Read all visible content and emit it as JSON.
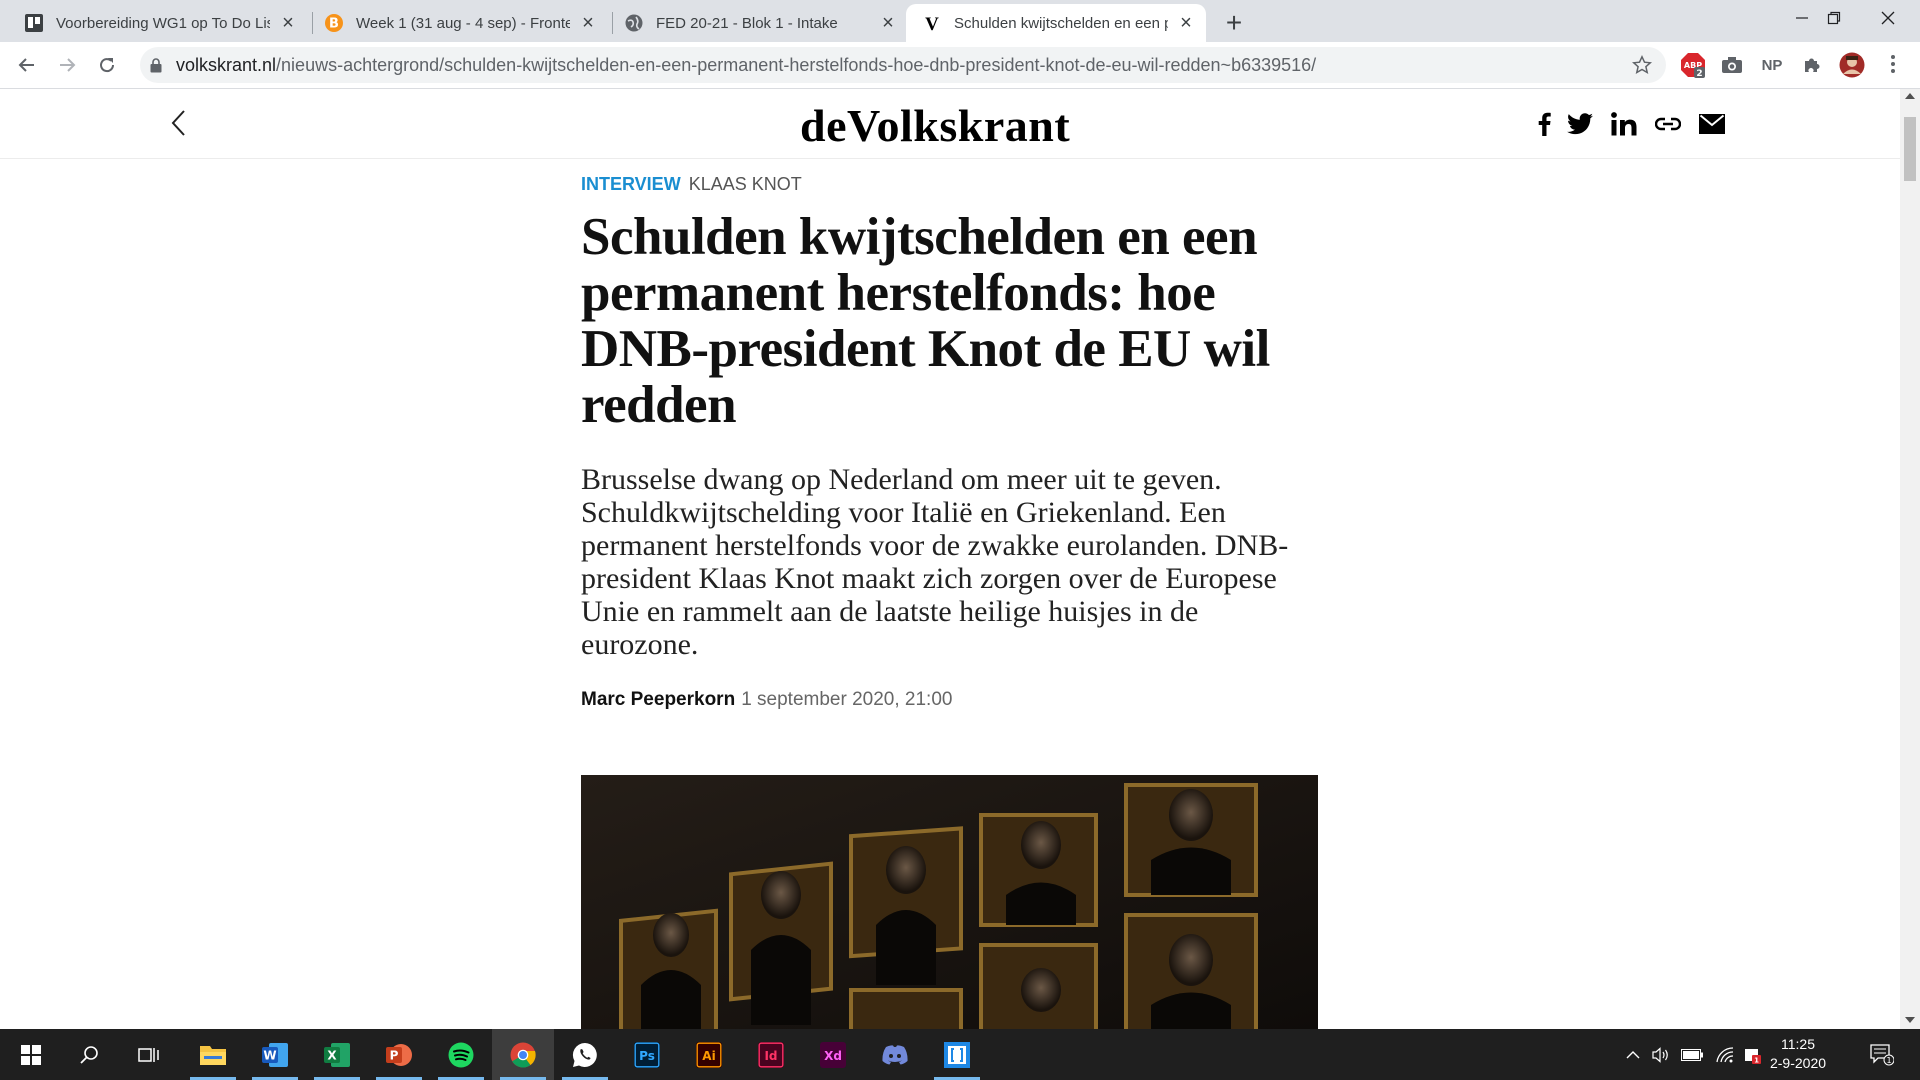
{
  "browser": {
    "tabs": [
      {
        "title": "Voorbereiding WG1 op To Do Lis",
        "favicon": "trello-icon"
      },
      {
        "title": "Week 1 (31 aug - 4 sep) - Fronter",
        "favicon": "bitcoin-icon"
      },
      {
        "title": "FED 20-21 - Blok 1 - Intake",
        "favicon": "globe-icon"
      },
      {
        "title": "Schulden kwijtschelden en een p",
        "favicon": "volkskrant-v-icon",
        "active": true
      }
    ],
    "url_domain": "volkskrant.nl",
    "url_path": "/nieuws-achtergrond/schulden-kwijtschelden-en-een-permanent-herstelfonds-hoe-dnb-president-knot-de-eu-wil-redden~b6339516/",
    "extensions": {
      "abp_badge": "2",
      "np_label": "NP"
    }
  },
  "site": {
    "logo": "deVolkskrant"
  },
  "article": {
    "kicker_tag": "INTERVIEW",
    "kicker_sub": "KLAAS KNOT",
    "headline": "Schulden kwijtschelden en een permanent herstelfonds: hoe DNB-president Knot de EU wil redden",
    "lead": "Brusselse dwang op Nederland om meer uit te geven. Schuldkwijtschelding voor Italië en Griekenland. Een permanent herstelfonds voor de zwakke eurolanden. DNB-president Klaas Knot maakt zich zorgen over de Europese Unie en rammelt aan de laatste heilige huisjes in de eurozone.",
    "author": "Marc Peeperkorn",
    "date": "1 september 2020, 21:00"
  },
  "taskbar": {
    "apps": [
      "windows-start",
      "search",
      "task-view",
      "file-explorer",
      "word",
      "excel",
      "powerpoint",
      "spotify",
      "chrome",
      "whatsapp",
      "photoshop",
      "illustrator",
      "indesign",
      "xd",
      "discord",
      "code-app"
    ],
    "time": "11:25",
    "date": "2-9-2020",
    "notification_count": "1"
  },
  "colors": {
    "accent": "#1a8ed1",
    "tabstrip": "#dee1e6",
    "taskbar": "#1f1f1f"
  }
}
